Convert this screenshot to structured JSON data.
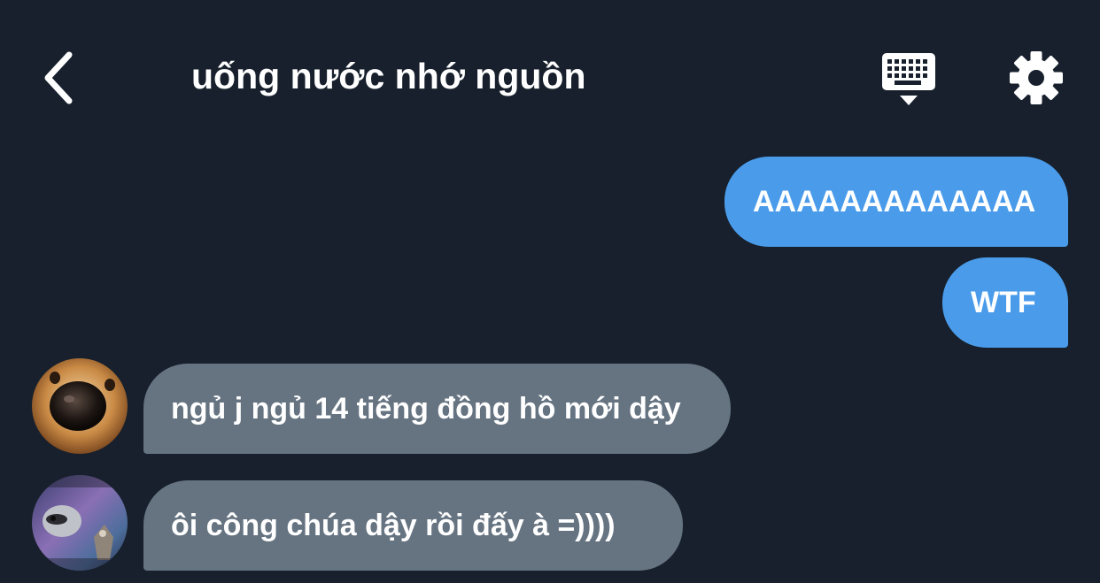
{
  "header": {
    "title": "uống nước nhớ nguồn",
    "back_icon": "chevron-left-icon",
    "keyboard_icon": "keyboard-icon",
    "settings_icon": "gear-icon"
  },
  "messages": [
    {
      "side": "outgoing",
      "text": "AAAAAAAAAAAAA"
    },
    {
      "side": "outgoing",
      "text": "WTF"
    },
    {
      "side": "incoming",
      "text": "ngủ j ngủ 14 tiếng đồng hồ mới dậy"
    },
    {
      "side": "incoming",
      "text": "ôi công chúa dậy rồi đấy à =))))"
    }
  ],
  "colors": {
    "background": "#17202c",
    "outgoing_bubble": "#4a9ceb",
    "incoming_bubble": "#667482",
    "text": "#ffffff"
  }
}
